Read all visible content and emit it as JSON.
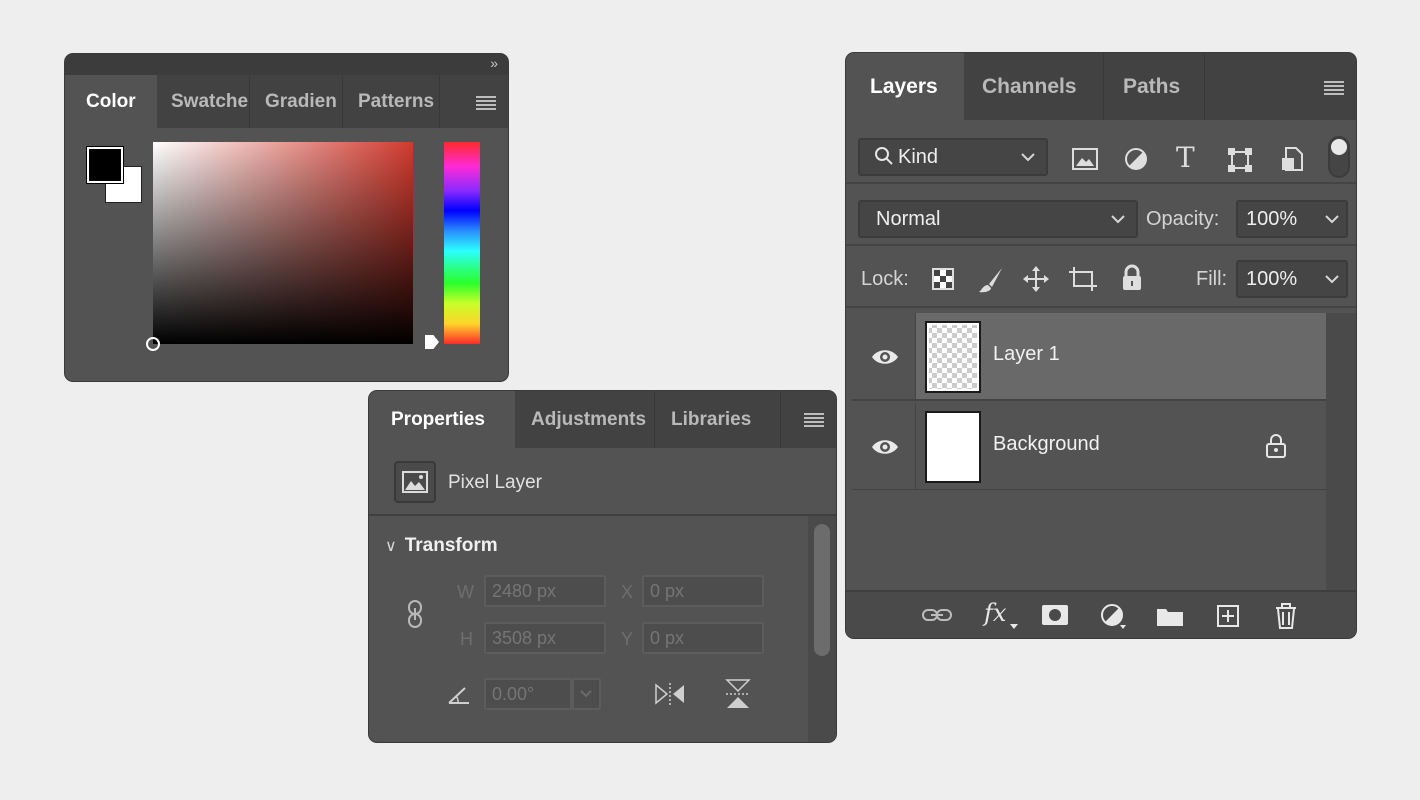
{
  "color_panel": {
    "collapse_glyph": "»",
    "tabs": [
      {
        "label": "Color",
        "active": true
      },
      {
        "label": "Swatche"
      },
      {
        "label": "Gradien"
      },
      {
        "label": "Patterns"
      }
    ],
    "foreground_color": "#000000",
    "background_color": "#ffffff",
    "picker_hue": "#d23a2e"
  },
  "properties_panel": {
    "tabs": [
      {
        "label": "Properties",
        "active": true
      },
      {
        "label": "Adjustments"
      },
      {
        "label": "Libraries"
      }
    ],
    "layer_type": "Pixel Layer",
    "section": {
      "chevron": "∨",
      "title": "Transform"
    },
    "labels": {
      "w": "W",
      "h": "H",
      "x": "X",
      "y": "Y"
    },
    "placeholders": {
      "w": "2480 px",
      "h": "3508 px",
      "x": "0 px",
      "y": "0 px",
      "angle": "0.00°"
    }
  },
  "layers_panel": {
    "tabs": [
      {
        "label": "Layers",
        "active": true
      },
      {
        "label": "Channels"
      },
      {
        "label": "Paths"
      }
    ],
    "filter": {
      "label": "Kind"
    },
    "blend_mode": "Normal",
    "opacity": {
      "label": "Opacity:",
      "value": "100%"
    },
    "lock_label": "Lock:",
    "fill": {
      "label": "Fill:",
      "value": "100%"
    },
    "type_filter_glyph": "T",
    "layers": [
      {
        "name": "Layer 1",
        "selected": true,
        "visible": true,
        "thumbnail": "transparent"
      },
      {
        "name": "Background",
        "selected": false,
        "visible": true,
        "locked": true,
        "thumbnail": "white"
      }
    ],
    "footer_fx": "fx"
  }
}
